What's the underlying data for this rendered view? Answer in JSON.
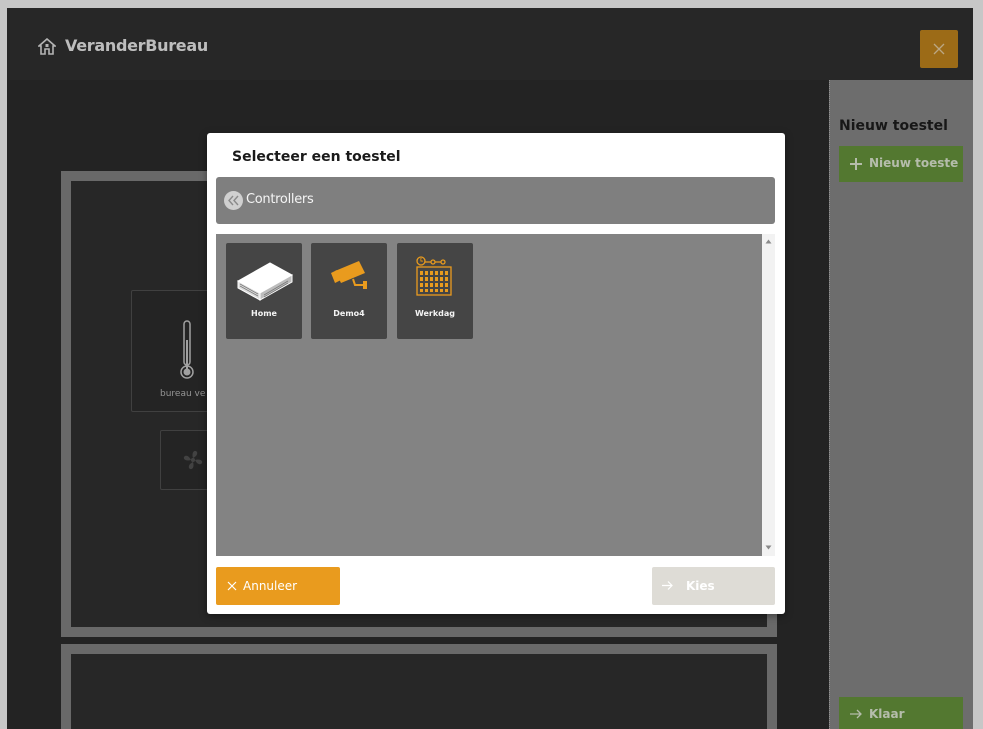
{
  "app": {
    "title": "VeranderBureau",
    "home_icon": "home-icon",
    "close_icon": "close-icon",
    "accent_color": "#e99b1e"
  },
  "workspace": {
    "thermostat_tile_label": "bureau ve",
    "thermostat_icon": "thermometer-icon",
    "fan_icon": "fan-icon"
  },
  "sidebar": {
    "title": "Nieuw toestel",
    "new_button_label": "Nieuw toeste",
    "done_button_label": "Klaar",
    "button_color": "#6b9a3e"
  },
  "modal": {
    "title": "Selecteer een toestel",
    "breadcrumb_label": "Controllers",
    "back_icon": "double-chevron-left-icon",
    "devices": [
      {
        "label": "Home",
        "icon": "controller-box-icon"
      },
      {
        "label": "Demo4",
        "icon": "camera-icon"
      },
      {
        "label": "Werkdag",
        "icon": "calendar-schedule-icon"
      }
    ],
    "cancel_label": "Annuleer",
    "choose_label": "Kies"
  }
}
